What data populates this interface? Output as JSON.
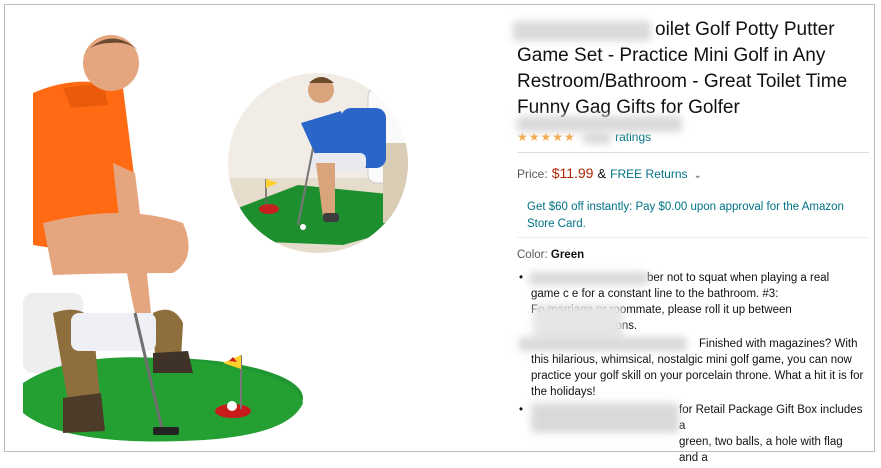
{
  "product": {
    "title_lines": [
      "oilet Golf Potty Putter",
      "Game Set - Practice Mini Golf in Any",
      "Restroom/Bathroom - Great Toilet Time",
      "Funny Gag Gifts for Golfer"
    ],
    "ratings_text": "ratings",
    "rating_stars": "★★★★★"
  },
  "price": {
    "label": "Price:",
    "value": "$11.99",
    "amp": "&",
    "free_returns": "FREE Returns",
    "chevron": "⌄"
  },
  "promo": {
    "text": "Get $60 off instantly: Pay $0.00 upon approval for the Amazon Store Card."
  },
  "color": {
    "label": "Color:",
    "value": "Green"
  },
  "bullets": [
    {
      "dot": "•",
      "lines": [
        "ber not to squat when playing a real",
        "game c e for a constant line to the bathroom. #3:",
        "Fo marriage or roommate, please roll it up between",
        "essions."
      ]
    },
    {
      "dot": "",
      "lines": [
        "Finished with magazines? With",
        "this hilarious, whimsical, nostalgic mini golf game, you can now",
        "practice your golf skill on your porcelain throne. What a hit it is for",
        "the holidays!"
      ]
    },
    {
      "dot": "•",
      "lines": [
        "for Retail Package Gift Box includes a",
        "green, two balls, a hole with flag and a"
      ]
    }
  ],
  "colors": {
    "price_red": "#B12704",
    "link_teal": "#007185",
    "star_orange": "#f3a847",
    "mat_green": "#1e8f2e",
    "shirt_orange": "#ff6a13",
    "shirt_blue": "#2a66c7"
  }
}
